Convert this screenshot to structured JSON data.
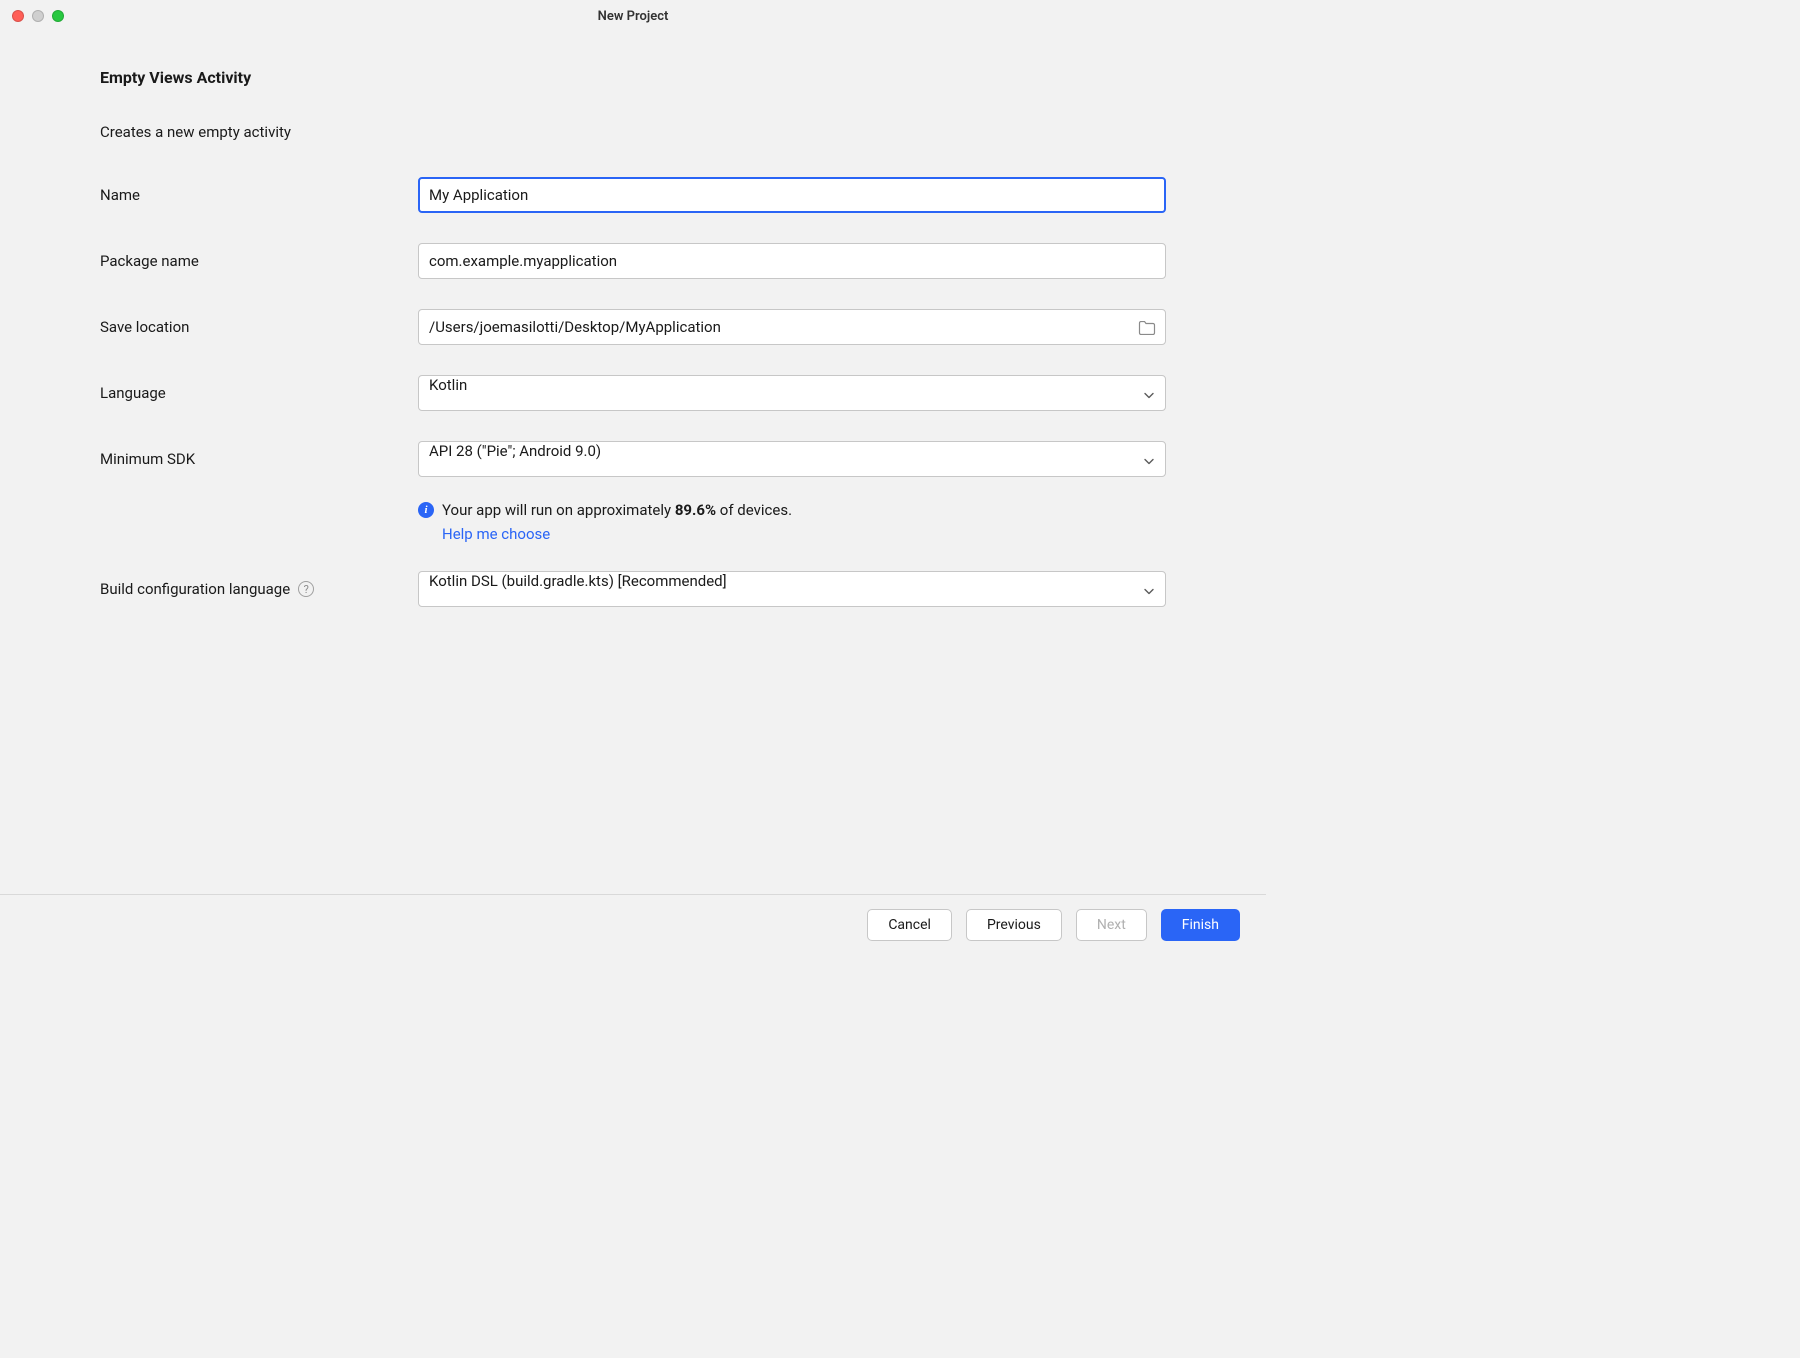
{
  "window": {
    "title": "New Project"
  },
  "page": {
    "heading": "Empty Views Activity",
    "subtitle": "Creates a new empty activity"
  },
  "form": {
    "name": {
      "label": "Name",
      "value": "My Application"
    },
    "package_name": {
      "label": "Package name",
      "value": "com.example.myapplication"
    },
    "save_location": {
      "label": "Save location",
      "value": "/Users/joemasilotti/Desktop/MyApplication"
    },
    "language": {
      "label": "Language",
      "value": "Kotlin"
    },
    "minimum_sdk": {
      "label": "Minimum SDK",
      "value": "API 28 (\"Pie\"; Android 9.0)"
    },
    "build_config": {
      "label": "Build configuration language",
      "value": "Kotlin DSL (build.gradle.kts) [Recommended]"
    }
  },
  "info": {
    "text_prefix": "Your app will run on approximately ",
    "percent": "89.6%",
    "text_suffix": " of devices.",
    "help_link": "Help me choose"
  },
  "footer": {
    "cancel": "Cancel",
    "previous": "Previous",
    "next": "Next",
    "finish": "Finish"
  }
}
